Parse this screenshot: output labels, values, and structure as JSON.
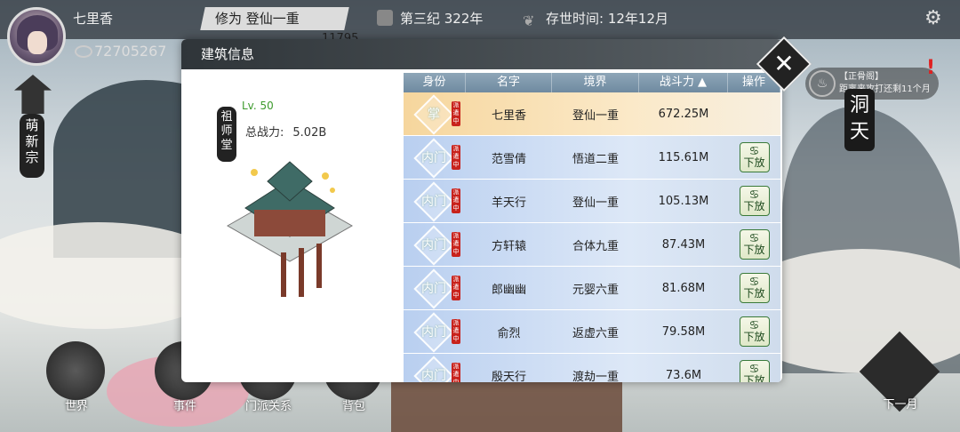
{
  "player": {
    "name": "七里香",
    "currency": "72705267",
    "secondary": "11795"
  },
  "topbar": {
    "realm": "修为  登仙一重",
    "era": "第三纪 322年",
    "survival": "存世时间: 12年12月"
  },
  "sect": {
    "name": "萌新宗"
  },
  "notice": {
    "tag": "【正骨阁】",
    "text": "距离来攻打还剩11个月"
  },
  "cave": {
    "label": "洞天"
  },
  "nav": {
    "world": "世界",
    "event": "事件",
    "relations": "门派关系",
    "bag": "背包",
    "next_month": "下一月"
  },
  "modal": {
    "title": "建筑信息",
    "building_name": "祖师堂",
    "level": "Lv. 50",
    "total_power_label": "总战力:",
    "total_power": "5.02B",
    "close_icon": "close-x"
  },
  "table": {
    "headers": [
      "身份",
      "名字",
      "境界",
      "战斗力 ▲",
      "操作"
    ],
    "rows": [
      {
        "role": "掌",
        "tag": "派遣中",
        "name": "七里香",
        "realm": "登仙一重",
        "power": "672.25M",
        "action": ""
      },
      {
        "role": "内门",
        "tag": "派遣中",
        "name": "范雪倩",
        "realm": "悟道二重",
        "power": "115.61M",
        "action": "下放"
      },
      {
        "role": "内门",
        "tag": "派遣中",
        "name": "羊天行",
        "realm": "登仙一重",
        "power": "105.13M",
        "action": "下放"
      },
      {
        "role": "内门",
        "tag": "派遣中",
        "name": "方轩辕",
        "realm": "合体九重",
        "power": "87.43M",
        "action": "下放"
      },
      {
        "role": "内门",
        "tag": "派遣中",
        "name": "郎幽幽",
        "realm": "元婴六重",
        "power": "81.68M",
        "action": "下放"
      },
      {
        "role": "内门",
        "tag": "派遣中",
        "name": "俞烈",
        "realm": "返虚六重",
        "power": "79.58M",
        "action": "下放"
      },
      {
        "role": "内门",
        "tag": "派遣中",
        "name": "殷天行",
        "realm": "渡劫一重",
        "power": "73.6M",
        "action": "下放"
      }
    ]
  }
}
